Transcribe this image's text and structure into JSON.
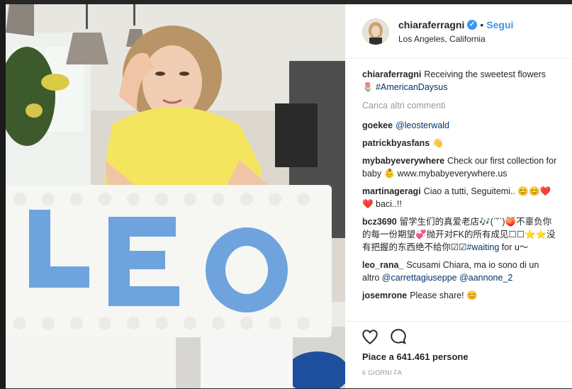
{
  "post": {
    "username": "chiaraferragni",
    "follow_label": "Segui",
    "location": "Los Angeles, California"
  },
  "caption": {
    "username": "chiaraferragni",
    "text": "Receiving the sweetest flowers 🌷 ",
    "hashtag": "#AmericanDaysus"
  },
  "load_more_label": "Carica altri commenti",
  "comments": [
    {
      "username": "goekee",
      "text": "",
      "mention": "@leosterwald"
    },
    {
      "username": "patrickbyasfans",
      "text": "👋",
      "mention": ""
    },
    {
      "username": "mybabyeverywhere",
      "text": "Check our first collection for baby 👶 www.mybabyeverywhere.us",
      "mention": ""
    },
    {
      "username": "martinageragi",
      "text": "Ciao a tutti, Seguitemi.. 😊😊❤️❤️ baci..!!",
      "mention": ""
    },
    {
      "username": "bcz3690",
      "text": "留学生们的真爱老店🎶(ˊ˘ˋ)🍑不辜负你的每一份期望💞抛开对FK的所有成见☐☐⭐⭐没有把握的东西绝不给你☑☑",
      "mention": "#waiting",
      "tail": " for u～"
    },
    {
      "username": "leo_rana_",
      "text": "Scusami Chiara, ma io sono di un altro ",
      "mention": "@carrettagiuseppe",
      "mention2": "@aannone_2"
    },
    {
      "username": "josemrone",
      "text": "Please share! 😊",
      "mention": ""
    }
  ],
  "likes_label": "Piace a 641.461 persone",
  "time_label": "6 GIORNI FA",
  "icons": {
    "like": "heart-outline-icon",
    "comment": "speech-bubble-icon",
    "verified": "verified-badge-icon"
  },
  "colors": {
    "accent": "#3897f0",
    "link": "#003569",
    "text": "#262626",
    "muted": "#999999"
  }
}
